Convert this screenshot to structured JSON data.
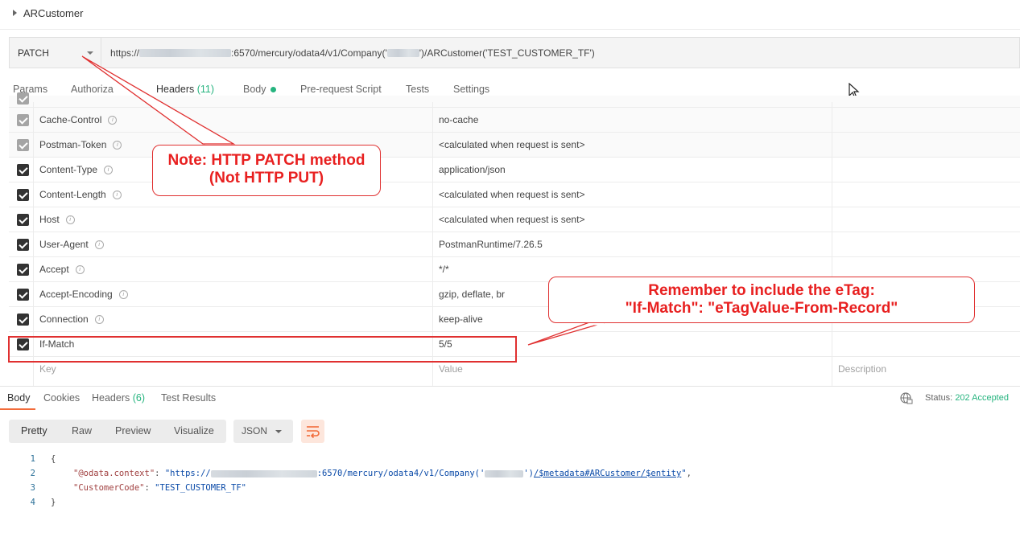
{
  "request": {
    "name": "ARCustomer",
    "method": "PATCH",
    "url_prefix": "https://",
    "url_mid": ":6570/mercury/odata4/v1/Company('",
    "url_suffix": "')/ARCustomer('TEST_CUSTOMER_TF')"
  },
  "tabs": [
    {
      "label": "Params"
    },
    {
      "label": "Authoriza"
    },
    {
      "label": "Headers",
      "count": "(11)"
    },
    {
      "label": "Body"
    },
    {
      "label": "Pre-request Script"
    },
    {
      "label": "Tests"
    },
    {
      "label": "Settings"
    }
  ],
  "headers": [
    {
      "key": "Cache-Control",
      "value": "no-cache",
      "auto": true
    },
    {
      "key": "Postman-Token",
      "value": "<calculated when request is sent>",
      "auto": true
    },
    {
      "key": "Content-Type",
      "value": "application/json",
      "auto": false
    },
    {
      "key": "Content-Length",
      "value": "<calculated when request is sent>",
      "auto": false
    },
    {
      "key": "Host",
      "value": "<calculated when request is sent>",
      "auto": false
    },
    {
      "key": "User-Agent",
      "value": "PostmanRuntime/7.26.5",
      "auto": false
    },
    {
      "key": "Accept",
      "value": "*/*",
      "auto": false
    },
    {
      "key": "Accept-Encoding",
      "value": "gzip, deflate, br",
      "auto": false
    },
    {
      "key": "Connection",
      "value": "keep-alive",
      "auto": false
    },
    {
      "key": "If-Match",
      "value": "5/5",
      "auto": false
    }
  ],
  "placeholders": {
    "key": "Key",
    "value": "Value",
    "description": "Description"
  },
  "response": {
    "tabs": [
      {
        "label": "Body"
      },
      {
        "label": "Cookies"
      },
      {
        "label": "Headers",
        "count": "(6)"
      },
      {
        "label": "Test Results"
      }
    ],
    "status_label": "Status:",
    "status_value": "202 Accepted",
    "formats": [
      "Pretty",
      "Raw",
      "Preview",
      "Visualize"
    ],
    "format_type": "JSON",
    "line_numbers": [
      "1",
      "2",
      "3",
      "4"
    ],
    "json": {
      "open": "{",
      "close": "}",
      "k1": "\"@odata.context\"",
      "v1_a": "\"https://",
      "v1_b": ":6570/mercury/odata4/v1/Company('",
      "v1_c": "')",
      "v1_link": "/$metadata#ARCustomer/$entity",
      "v1_end": "\"",
      "k2": "\"CustomerCode\"",
      "v2": "\"TEST_CUSTOMER_TF\""
    }
  },
  "annotations": {
    "note1_line1": "Note: HTTP PATCH method",
    "note1_line2": "(Not HTTP PUT)",
    "note2_line1": "Remember to include the eTag:",
    "note2_line2": "\"If-Match\": \"eTagValue-From-Record\""
  },
  "colors": {
    "accent": "#f26b3a",
    "success": "#26b47f",
    "annotation": "#e03030"
  }
}
